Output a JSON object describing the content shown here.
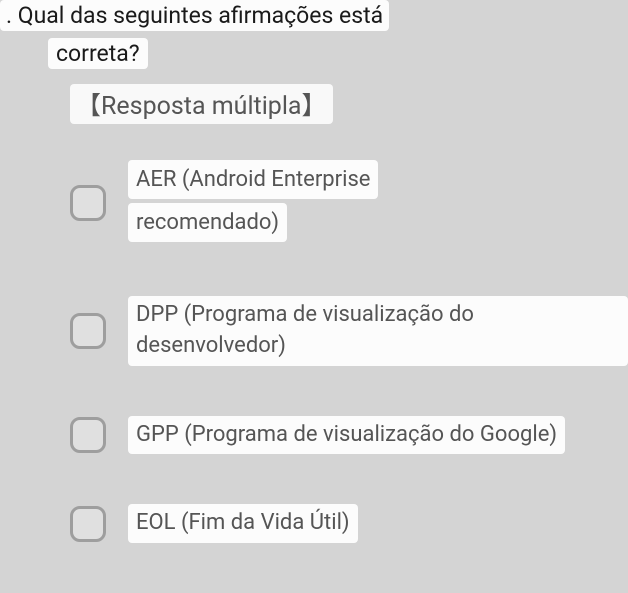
{
  "question": {
    "line1": ". Qual das seguintes afirmações está",
    "line2": "correta?"
  },
  "subtitle": "【Resposta múltipla】",
  "options": [
    {
      "line1": "AER (Android Enterprise",
      "line2": "recomendado)"
    },
    {
      "text": "DPP (Programa de visualização do desenvolvedor)"
    },
    {
      "text": "GPP (Programa de visualização do Google)"
    },
    {
      "text": "EOL (Fim da Vida Útil)"
    }
  ]
}
